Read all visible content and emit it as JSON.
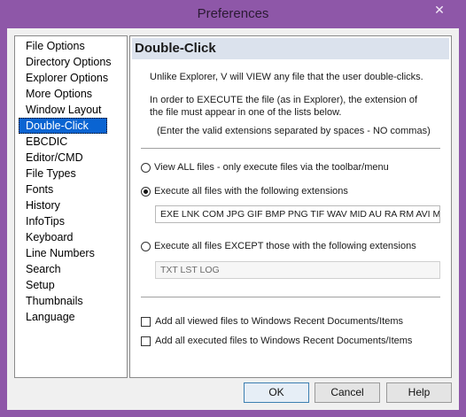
{
  "window": {
    "title": "Preferences",
    "close_glyph": "✕"
  },
  "sidebar": {
    "items": [
      {
        "label": "File Options"
      },
      {
        "label": "Directory Options"
      },
      {
        "label": "Explorer Options"
      },
      {
        "label": "More Options"
      },
      {
        "label": "Window Layout"
      },
      {
        "label": "Double-Click",
        "selected": true
      },
      {
        "label": "EBCDIC"
      },
      {
        "label": "Editor/CMD"
      },
      {
        "label": "File Types"
      },
      {
        "label": "Fonts"
      },
      {
        "label": "History"
      },
      {
        "label": "InfoTips"
      },
      {
        "label": "Keyboard"
      },
      {
        "label": "Line Numbers"
      },
      {
        "label": "Search"
      },
      {
        "label": "Setup"
      },
      {
        "label": "Thumbnails"
      },
      {
        "label": "Language"
      }
    ]
  },
  "panel": {
    "header": "Double-Click",
    "desc1": "Unlike Explorer, V will VIEW any file that the user double-clicks.",
    "desc2": "In order to EXECUTE the file (as in Explorer), the extension of",
    "desc3": "the file must appear in one of the lists below.",
    "desc4": "(Enter the valid extensions separated by spaces - NO commas)",
    "options": {
      "view_all": "View ALL files - only execute files via the toolbar/menu",
      "execute_with": "Execute all files with the following extensions",
      "execute_except": "Execute all files EXCEPT those with the following extensions",
      "selected": "execute_with"
    },
    "execute_extensions": "EXE LNK COM JPG GIF BMP PNG TIF WAV MID AU RA RM AVI MPG",
    "except_extensions": "TXT LST LOG",
    "checks": {
      "recent_viewed": "Add all viewed files to Windows Recent Documents/Items",
      "recent_executed": "Add all executed files to Windows Recent Documents/Items"
    }
  },
  "buttons": {
    "ok": "OK",
    "cancel": "Cancel",
    "help": "Help"
  }
}
